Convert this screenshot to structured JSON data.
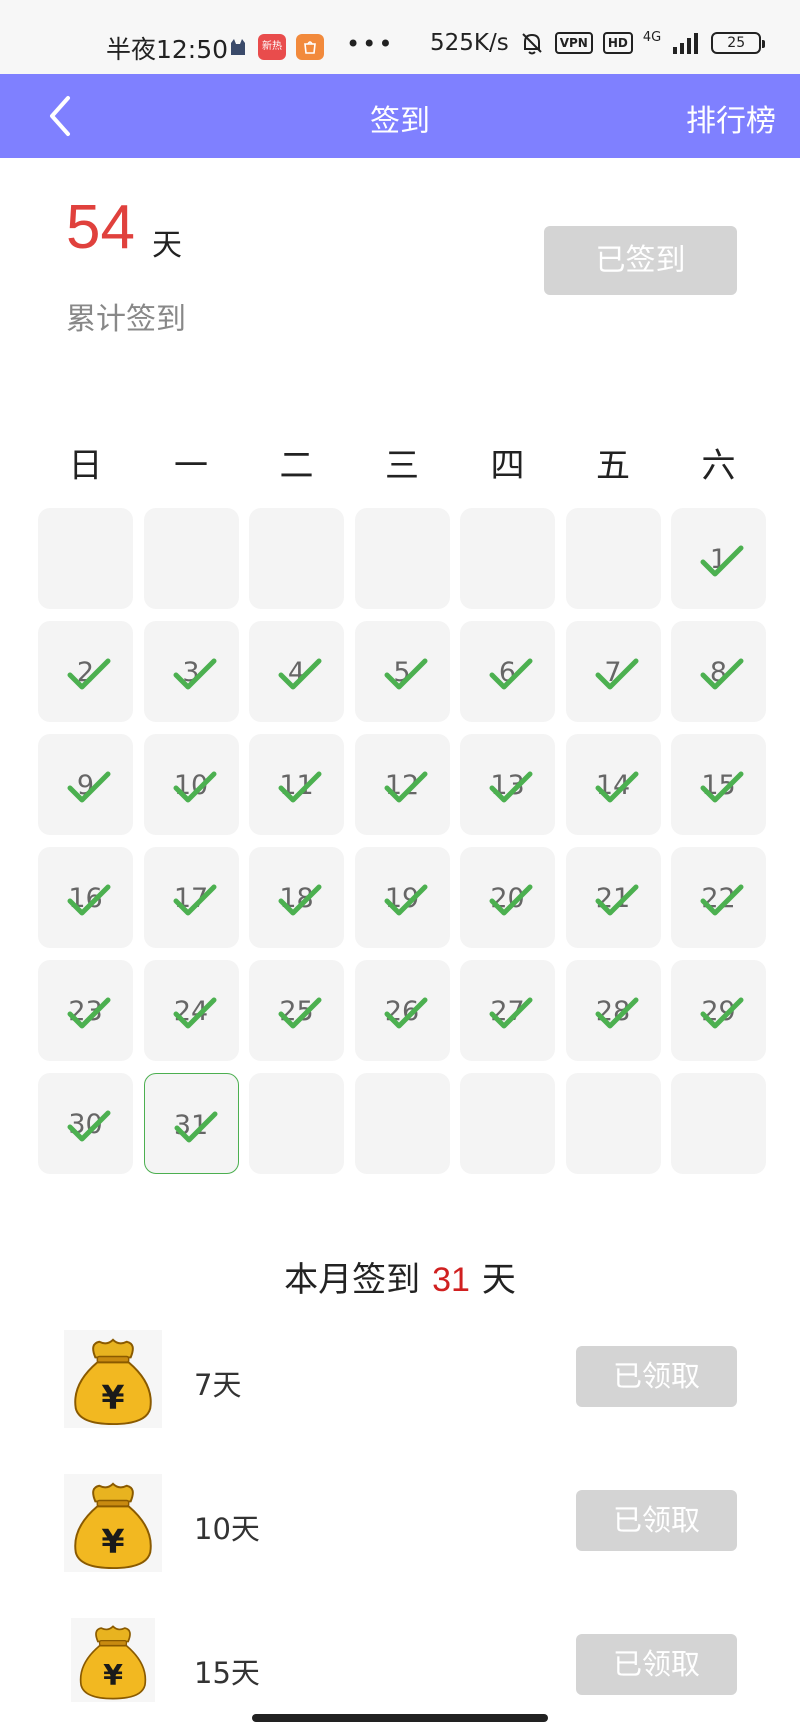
{
  "status_bar": {
    "time": "半夜12:50",
    "app_badge_1": "新热",
    "more": "•••",
    "net_speed": "525K/s",
    "vpn": "VPN",
    "hd": "HD",
    "network": "4G",
    "battery": "25"
  },
  "header": {
    "title": "签到",
    "rank_label": "排行榜",
    "background": "#7f80ff"
  },
  "summary": {
    "total_days": "54",
    "unit": "天",
    "label": "累计签到",
    "signed_button": "已签到"
  },
  "calendar": {
    "weekdays": [
      "日",
      "一",
      "二",
      "三",
      "四",
      "五",
      "六"
    ],
    "leading_blanks": 6,
    "days_in_month": 31,
    "checked_days": [
      1,
      2,
      3,
      4,
      5,
      6,
      7,
      8,
      9,
      10,
      11,
      12,
      13,
      14,
      15,
      16,
      17,
      18,
      19,
      20,
      21,
      22,
      23,
      24,
      25,
      26,
      27,
      28,
      29,
      30,
      31
    ],
    "today": 31,
    "check_color": "#4cb050"
  },
  "month_summary": {
    "prefix": "本月签到",
    "count": "31",
    "suffix": "天"
  },
  "rewards": [
    {
      "label": "7天",
      "button": "已领取",
      "icon": "money-bag-icon"
    },
    {
      "label": "10天",
      "button": "已领取",
      "icon": "money-bag-icon"
    },
    {
      "label": "15天",
      "button": "已领取",
      "icon": "money-bag-icon"
    }
  ]
}
